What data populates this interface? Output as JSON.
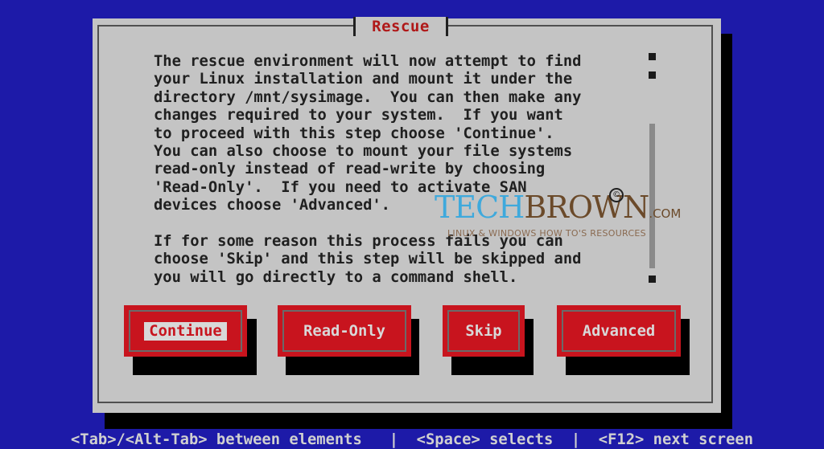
{
  "dialog": {
    "title": "Rescue",
    "body": "The rescue environment will now attempt to find\nyour Linux installation and mount it under the\ndirectory /mnt/sysimage.  You can then make any\nchanges required to your system.  If you want\nto proceed with this step choose 'Continue'.\nYou can also choose to mount your file systems\nread-only instead of read-write by choosing\n'Read-Only'.  If you need to activate SAN\ndevices choose 'Advanced'.\n\nIf for some reason this process fails you can\nchoose 'Skip' and this step will be skipped and\nyou will go directly to a command shell."
  },
  "buttons": {
    "continue": "Continue",
    "read_only": "Read-Only",
    "skip": "Skip",
    "advanced": "Advanced"
  },
  "status_bar": {
    "text": "<Tab>/<Alt-Tab> between elements   |  <Space> selects  |  <F12> next screen"
  },
  "watermark": {
    "tech": "TECH",
    "brown": "BROWN",
    "com": ".COM",
    "tagline": "LINUX & WINDOWS HOW TO'S RESOURCES"
  },
  "colors": {
    "background": "#1d1aa8",
    "dialog": "#c4c4c4",
    "button": "#c8141e",
    "title": "#b01818"
  }
}
